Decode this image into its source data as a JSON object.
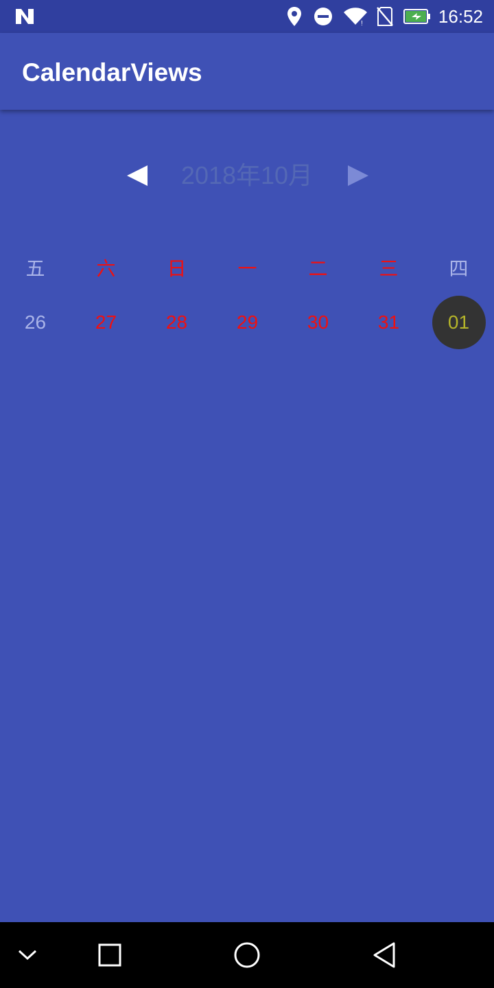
{
  "status_bar": {
    "time": "16:52",
    "icons": [
      "notification-n-icon",
      "location-icon",
      "do-not-disturb-icon",
      "wifi-icon",
      "no-sim-icon",
      "battery-charging-icon"
    ]
  },
  "app_bar": {
    "title": "CalendarViews"
  },
  "calendar": {
    "month_title": "2018年10月",
    "prev_icon": "triangle-left-icon",
    "next_icon": "triangle-right-icon",
    "weekdays": [
      "五",
      "六",
      "日",
      "一",
      "二",
      "三",
      "四"
    ],
    "dates": [
      "26",
      "27",
      "28",
      "29",
      "30",
      "31",
      "01"
    ],
    "selected_date": "01"
  },
  "colors": {
    "primary": "#3f51b5",
    "primary_dark": "#303f9f",
    "holiday_red": "#f01010",
    "muted_text": "#aab4e8",
    "selected_bg": "#333333",
    "selected_text": "#b5b52a"
  },
  "nav_bar": {
    "icons": [
      "chevron-down-icon",
      "recents-square-icon",
      "home-circle-icon",
      "back-triangle-icon"
    ]
  }
}
